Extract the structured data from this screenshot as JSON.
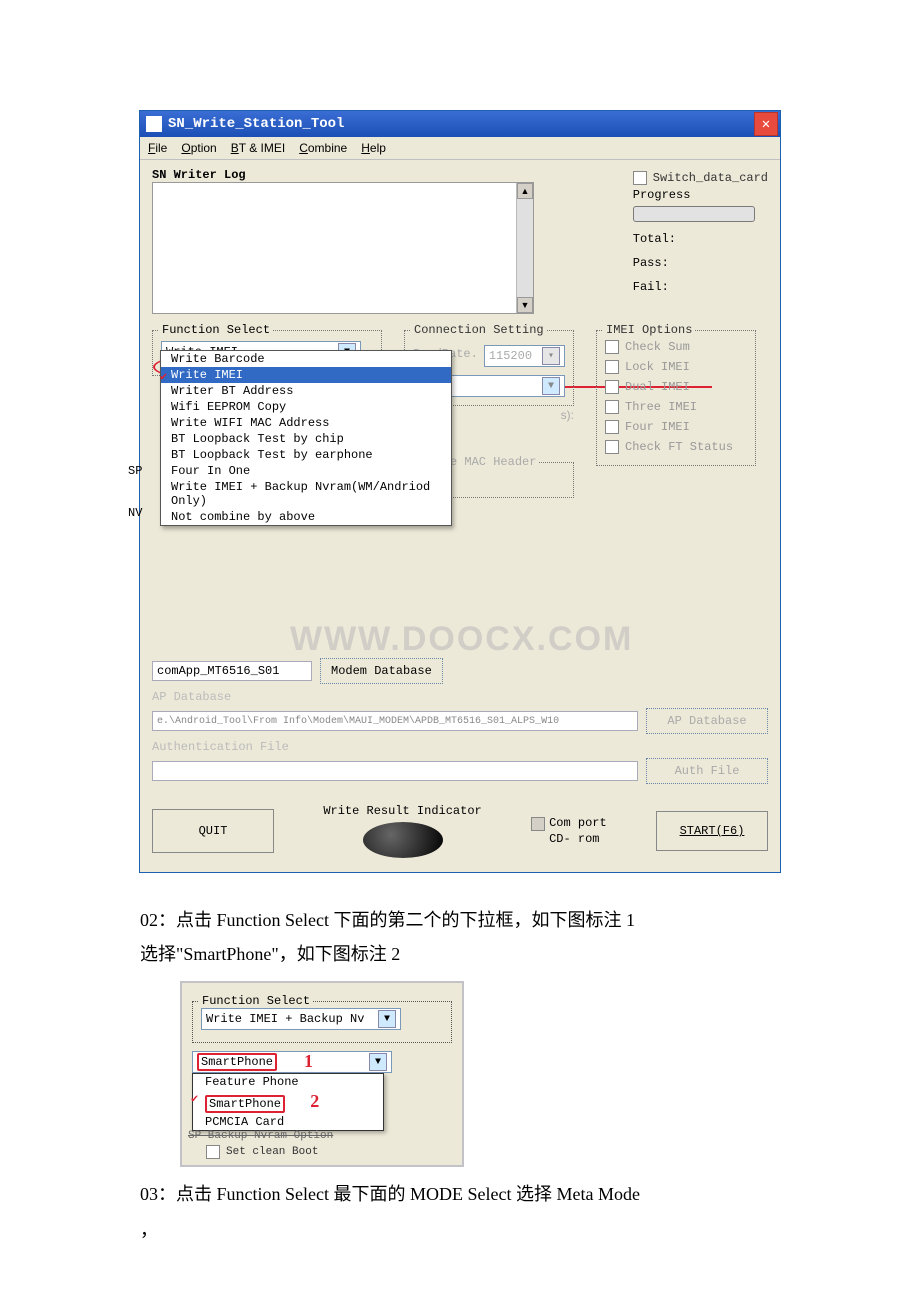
{
  "screenshot1": {
    "title": "SN_Write_Station_Tool",
    "menubar": [
      "File",
      "Option",
      "BT & IMEI",
      "Combine",
      "Help"
    ],
    "log_label": "SN Writer Log",
    "right_panel": {
      "switch_label": "Switch_data_card",
      "progress_label": "Progress",
      "total_label": "Total:",
      "pass_label": "Pass:",
      "fail_label": "Fail:"
    },
    "function_select": {
      "legend": "Function Select",
      "selected": "Write IMEI",
      "options": [
        "Write Barcode",
        "Write IMEI",
        "Writer BT Address",
        "Wifi EEPROM Copy",
        "Write WIFI MAC Address",
        "BT Loopback Test by chip",
        "BT Loopback Test by earphone",
        "Four In One",
        "Write IMEI + Backup Nvram(WM/Andriod Only)",
        "Not combine by above"
      ]
    },
    "connection_setting": {
      "legend": "Connection Setting",
      "baud_label": "BaudRate.",
      "baud_value": "115200",
      "s_suffix": "s):"
    },
    "imei_options": {
      "legend": "IMEI Options",
      "items": [
        "Check Sum",
        "Lock IMEI",
        "Dual IMEI",
        "Three IMEI",
        "Four IMEI",
        "Check FT Status"
      ]
    },
    "enable_mac_header": "Enable MAC Header",
    "sp_label": "SP",
    "nv_label": "NV",
    "ap_database_legend": "AP Database",
    "ap_path": "e.\\Android_Tool\\From Info\\Modem\\MAUI_MODEM\\APDB_MT6516_S01_ALPS_W10",
    "auth_file_label": "Authentication File",
    "modem_field": "comApp_MT6516_S01",
    "modem_database_btn": "Modem Database",
    "ap_database_btn": "AP Database",
    "auth_file_btn": "Auth File",
    "write_result_label": "Write Result Indicator",
    "quit_btn": "QUIT",
    "comport_label_1": "Com port",
    "comport_label_2": "CD- rom",
    "start_btn": "START(F6)",
    "watermark": "WWW.DOOCX.COM"
  },
  "caption1_line1": "02：点击 Function Select 下面的第二个的下拉框，如下图标注 1",
  "caption1_line2": "选择\"SmartPhone\"，如下图标注 2",
  "screenshot2": {
    "legend": "Function Select",
    "top_value": "Write IMEI + Backup Nv",
    "selected": "SmartPhone",
    "options": [
      "Feature Phone",
      "SmartPhone",
      "PCMCIA Card"
    ],
    "annot1": "1",
    "annot2": "2",
    "sp_line": "SP  Backup Nvram Option",
    "set_clean_boot": "Set clean Boot"
  },
  "caption2": "03：点击 Function Select 最下面的 MODE Select 选择 Meta Mode",
  "trailing_comma": "，"
}
